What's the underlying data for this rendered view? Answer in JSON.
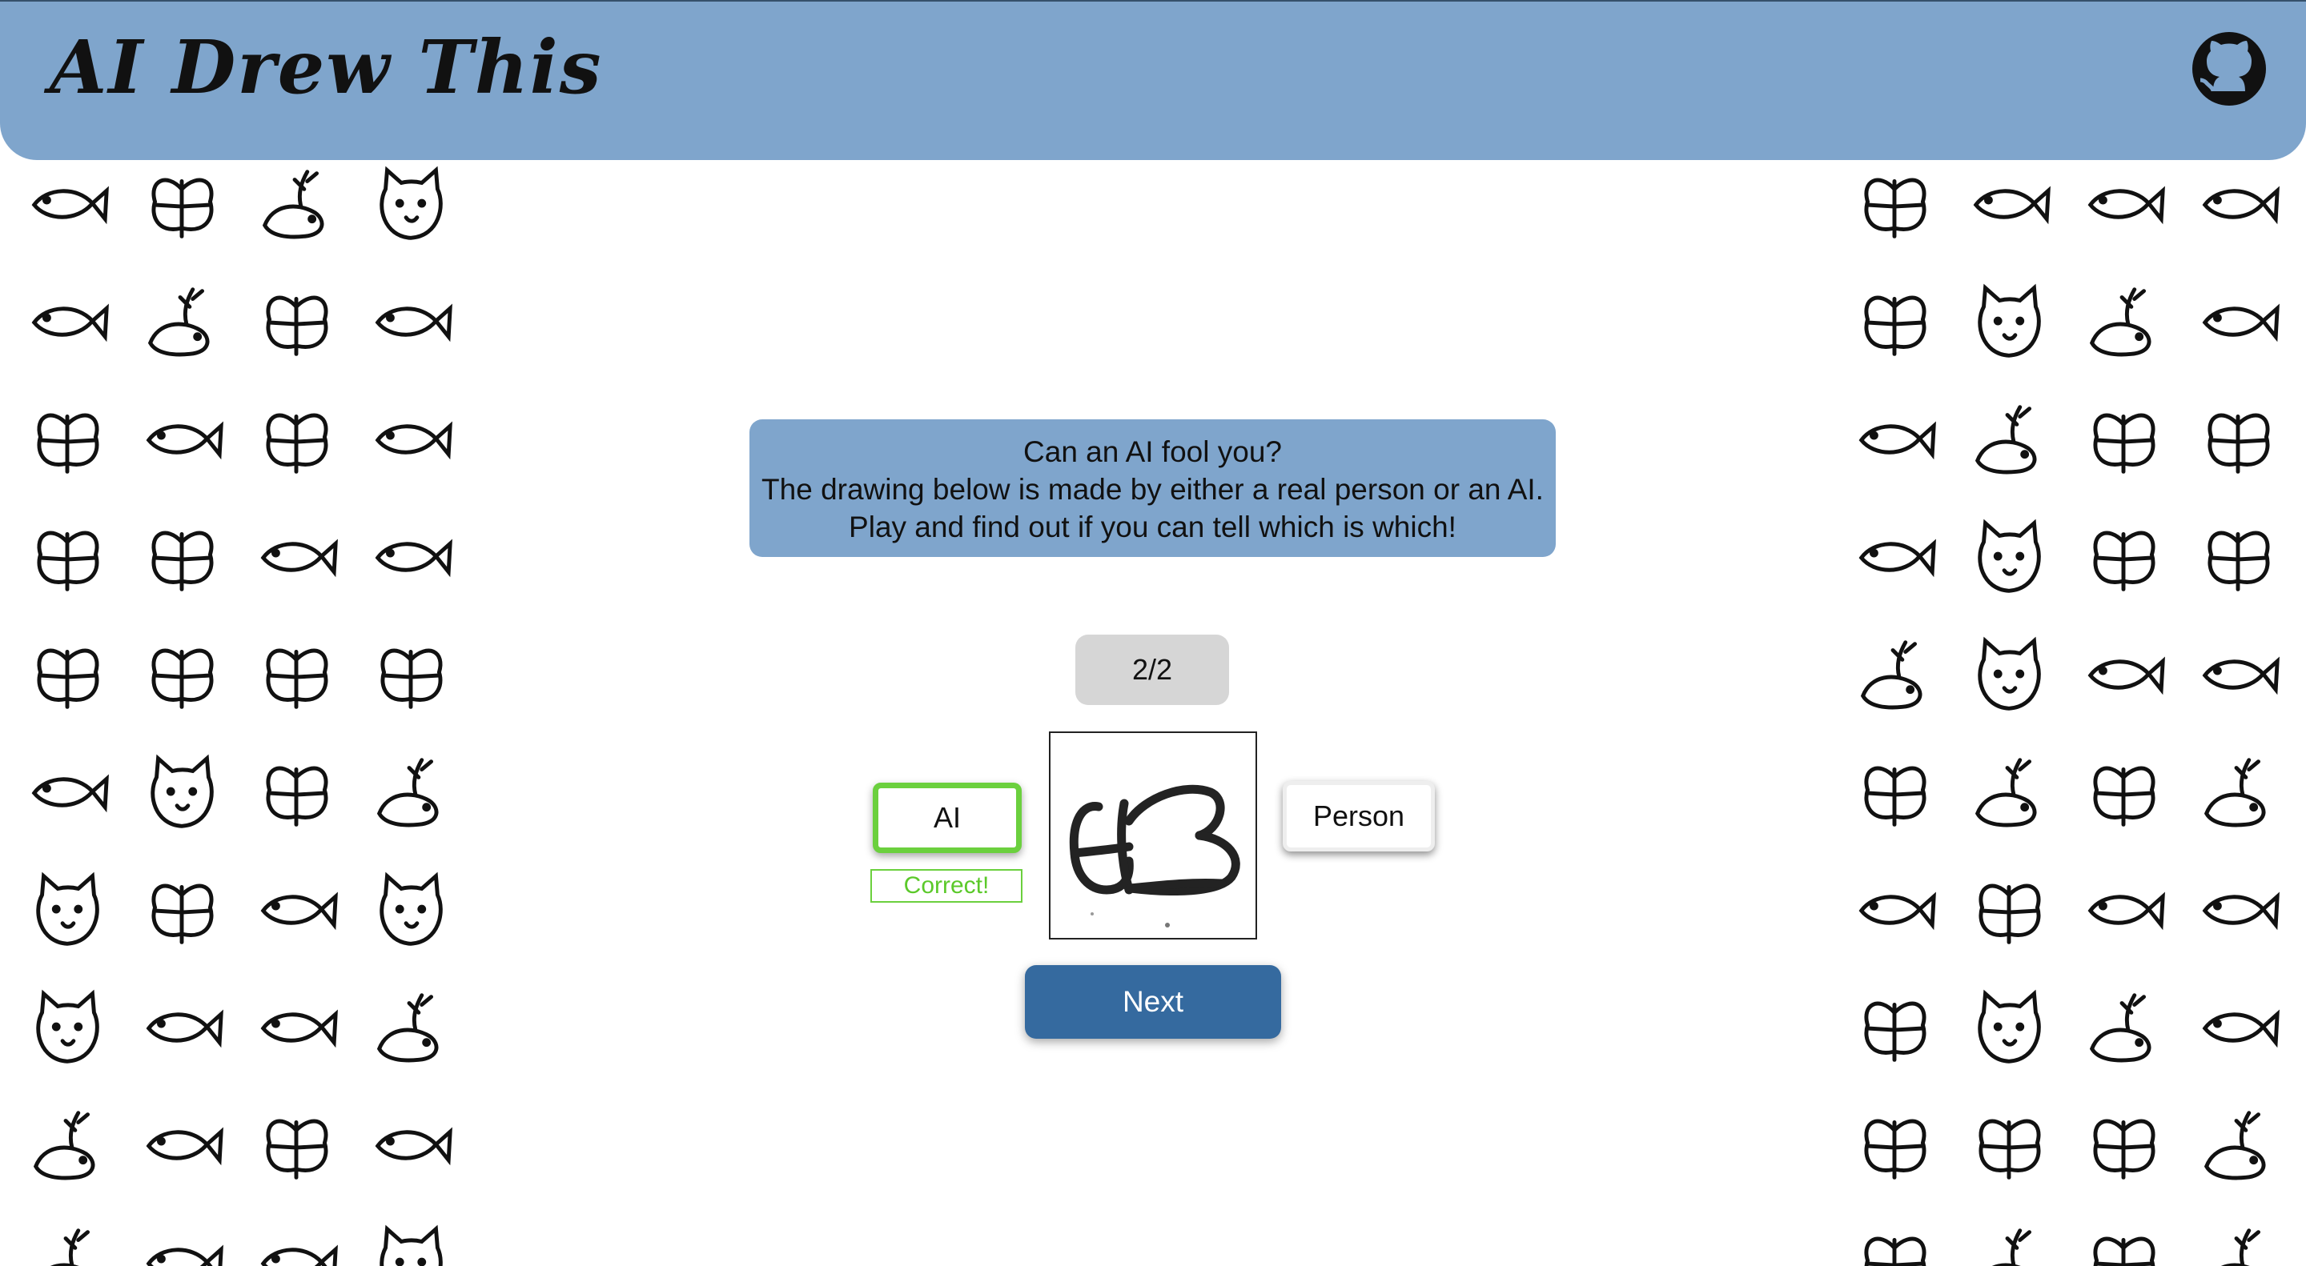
{
  "header": {
    "title": "AI Drew This",
    "github_icon": "github-icon",
    "colors": {
      "header_bg": "#7fa5cc"
    }
  },
  "intro": {
    "line1": "Can an AI fool you?",
    "line2": "The drawing below is made by either a real person or an AI.",
    "line3": "Play and find out if you can tell which is which!"
  },
  "game": {
    "counter": "2/2",
    "ai_label": "AI",
    "person_label": "Person",
    "result": "Correct!",
    "next_label": "Next",
    "drawing_subject": "butterfly",
    "colors": {
      "correct": "#6bd03e",
      "next_bg": "#356a9f"
    }
  },
  "sidebars": {
    "left": [
      "fish",
      "butterfly",
      "bird",
      "cat",
      "fish",
      "bird",
      "butterfly",
      "fish",
      "butterfly",
      "fish",
      "butterfly",
      "fish",
      "butterfly",
      "butterfly",
      "fish",
      "fish",
      "butterfly",
      "butterfly",
      "butterfly",
      "butterfly",
      "fish",
      "cat",
      "butterfly",
      "bird",
      "cat",
      "butterfly",
      "fish",
      "cat",
      "cat",
      "fish",
      "fish",
      "bird",
      "bird",
      "fish",
      "butterfly",
      "fish",
      "bird",
      "fish",
      "fish",
      "cat"
    ],
    "right": [
      "butterfly",
      "fish",
      "fish",
      "fish",
      "butterfly",
      "cat",
      "bird",
      "fish",
      "fish",
      "bird",
      "butterfly",
      "butterfly",
      "fish",
      "cat",
      "butterfly",
      "butterfly",
      "bird",
      "cat",
      "fish",
      "fish",
      "butterfly",
      "bird",
      "butterfly",
      "bird",
      "fish",
      "butterfly",
      "fish",
      "fish",
      "butterfly",
      "cat",
      "bird",
      "fish",
      "butterfly",
      "butterfly",
      "butterfly",
      "bird",
      "butterfly",
      "bird",
      "butterfly",
      "bird"
    ]
  }
}
